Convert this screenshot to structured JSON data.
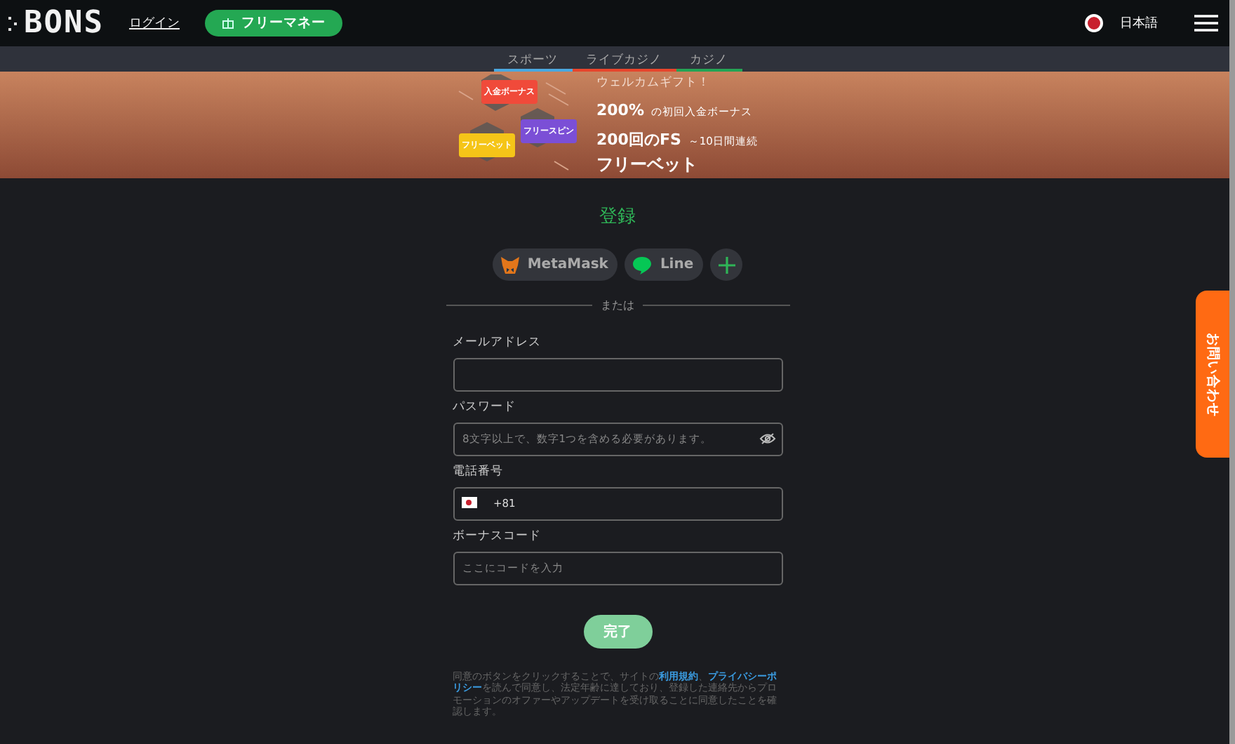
{
  "header": {
    "logo": "BONS",
    "login": "ログイン",
    "free_money": "フリーマネー",
    "language": "日本語"
  },
  "subnav": [
    {
      "label": "スポーツ",
      "color": "#4aa8e0",
      "selected": false
    },
    {
      "label": "ライブカジノ",
      "color": "#e8452c",
      "selected": false
    },
    {
      "label": "カジノ",
      "color": "#23a455",
      "selected": false
    }
  ],
  "banner": {
    "badges": [
      {
        "label": "入金ボーナス",
        "color": "#f04a3a"
      },
      {
        "label": "フリーベット",
        "color": "#f5c518"
      },
      {
        "label": "フリースピン",
        "color": "#7b4fd6"
      }
    ],
    "greeting": "ウェルカムギフト！",
    "line1_big": "200%",
    "line1_small": "の初回入金ボーナス",
    "line2_big": "200回のFS",
    "line2_small": "～10日間連続",
    "line3": "フリーベット"
  },
  "form": {
    "title": "登録",
    "social": [
      {
        "kind": "metamask",
        "label": "MetaMask"
      },
      {
        "kind": "line",
        "label": "Line"
      },
      {
        "kind": "more"
      }
    ],
    "divider": "または",
    "fields": [
      {
        "kind": "text",
        "label": "メールアドレス"
      },
      {
        "kind": "password",
        "label": "パスワード",
        "placeholder": "8文字以上で、数字1つを含める必要があります。"
      },
      {
        "kind": "phone",
        "label": "電話番号",
        "value": "+81"
      },
      {
        "kind": "text",
        "label": "ボーナスコード",
        "placeholder": "ここにコードを入力"
      }
    ],
    "submit": "完了",
    "terms": "同意のボタンをクリックすることで、サイトの**利用規約**、**プライバシーポリシー**を読んで同意し、法定年齢に達しており、登録した連絡先からプロモーションのオファーやアップデートを受け取ることに同意したことを確認します。"
  },
  "contact_tab": "お問い合わせ"
}
